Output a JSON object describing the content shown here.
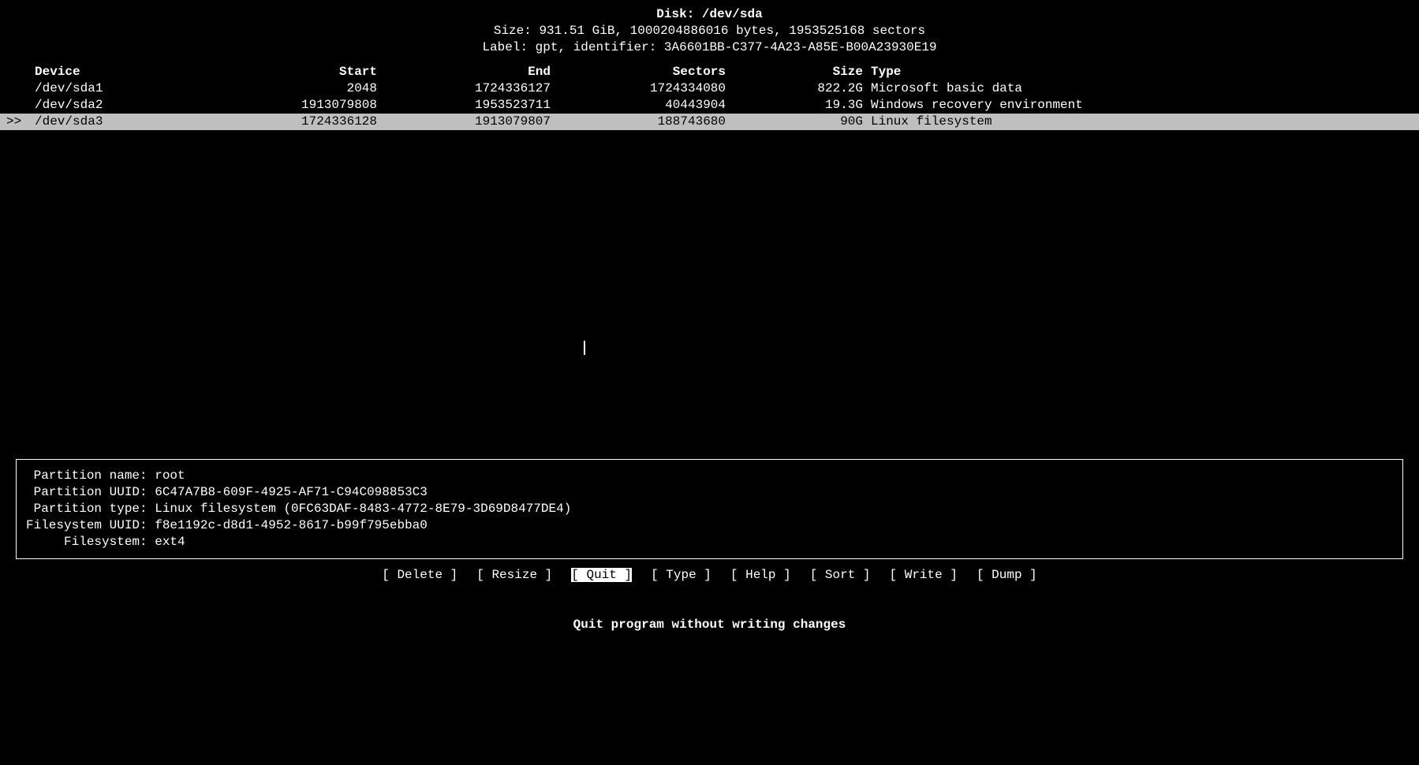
{
  "header": {
    "disk_label": "Disk: ",
    "disk_path": "/dev/sda",
    "size_line": "Size: 931.51 GiB, 1000204886016 bytes, 1953525168 sectors",
    "label_line": "Label: gpt, identifier: 3A6601BB-C377-4A23-A85E-B00A23930E19"
  },
  "columns": {
    "device": "Device",
    "start": "Start",
    "end": "End",
    "sectors": "Sectors",
    "size": "Size",
    "type": "Type"
  },
  "partitions": [
    {
      "marker": "",
      "device": "/dev/sda1",
      "start": "2048",
      "end": "1724336127",
      "sectors": "1724334080",
      "size": "822.2G",
      "type": "Microsoft basic data",
      "selected": false
    },
    {
      "marker": "",
      "device": "/dev/sda2",
      "start": "1913079808",
      "end": "1953523711",
      "sectors": "40443904",
      "size": "19.3G",
      "type": "Windows recovery environment",
      "selected": false
    },
    {
      "marker": ">>",
      "device": "/dev/sda3",
      "start": "1724336128",
      "end": "1913079807",
      "sectors": "188743680",
      "size": "90G",
      "type": "Linux filesystem",
      "selected": true
    }
  ],
  "info": {
    "line1": " Partition name: root",
    "line2": " Partition UUID: 6C47A7B8-609F-4925-AF71-C94C098853C3",
    "line3": " Partition type: Linux filesystem (0FC63DAF-8483-4772-8E79-3D69D8477DE4)",
    "line4": "Filesystem UUID: f8e1192c-d8d1-4952-8617-b99f795ebba0",
    "line5": "     Filesystem: ext4"
  },
  "menu": {
    "items": [
      {
        "label": "[ Delete ]",
        "selected": false
      },
      {
        "label": "[ Resize ]",
        "selected": false
      },
      {
        "label": "[  Quit  ]",
        "selected": true
      },
      {
        "label": "[  Type  ]",
        "selected": false
      },
      {
        "label": "[  Help  ]",
        "selected": false
      },
      {
        "label": "[  Sort  ]",
        "selected": false
      },
      {
        "label": "[ Write ]",
        "selected": false
      },
      {
        "label": "[  Dump  ]",
        "selected": false
      }
    ]
  },
  "hint": "Quit program without writing changes"
}
